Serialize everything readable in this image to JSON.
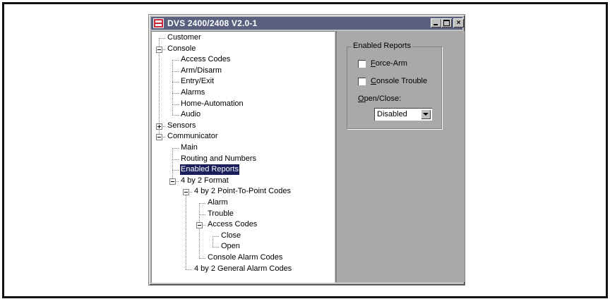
{
  "window": {
    "title": "DVS 2400/2408 V2.0-1",
    "icons": {
      "app": "dvs-app-icon",
      "minimize": "minimize-icon",
      "maximize": "maximize-icon",
      "close": "close-icon"
    },
    "close_glyph": "×"
  },
  "tree": {
    "selected": "Enabled Reports",
    "items": [
      {
        "label": "Customer",
        "depth": 0,
        "expander": "none"
      },
      {
        "label": "Console",
        "depth": 0,
        "expander": "minus"
      },
      {
        "label": "Access Codes",
        "depth": 1,
        "expander": "none"
      },
      {
        "label": "Arm/Disarm",
        "depth": 1,
        "expander": "none"
      },
      {
        "label": "Entry/Exit",
        "depth": 1,
        "expander": "none"
      },
      {
        "label": "Alarms",
        "depth": 1,
        "expander": "none"
      },
      {
        "label": "Home-Automation",
        "depth": 1,
        "expander": "none"
      },
      {
        "label": "Audio",
        "depth": 1,
        "expander": "none"
      },
      {
        "label": "Sensors",
        "depth": 0,
        "expander": "plus"
      },
      {
        "label": "Communicator",
        "depth": 0,
        "expander": "minus"
      },
      {
        "label": "Main",
        "depth": 1,
        "expander": "none"
      },
      {
        "label": "Routing and Numbers",
        "depth": 1,
        "expander": "none"
      },
      {
        "label": "Enabled Reports",
        "depth": 1,
        "expander": "none"
      },
      {
        "label": "4 by 2 Format",
        "depth": 1,
        "expander": "minus"
      },
      {
        "label": "4 by 2 Point-To-Point Codes",
        "depth": 2,
        "expander": "minus"
      },
      {
        "label": "Alarm",
        "depth": 3,
        "expander": "none"
      },
      {
        "label": "Trouble",
        "depth": 3,
        "expander": "none"
      },
      {
        "label": "Access Codes",
        "depth": 3,
        "expander": "minus"
      },
      {
        "label": "Close",
        "depth": 4,
        "expander": "none"
      },
      {
        "label": "Open",
        "depth": 4,
        "expander": "none"
      },
      {
        "label": "Console Alarm Codes",
        "depth": 3,
        "expander": "none"
      },
      {
        "label": "4 by 2 General Alarm Codes",
        "depth": 2,
        "expander": "none"
      }
    ]
  },
  "panel": {
    "group_title": "Enabled Reports",
    "force_arm": {
      "label_first": "F",
      "label_rest": "orce-Arm",
      "checked": false
    },
    "console_trouble": {
      "label_first": "C",
      "label_rest": "onsole Trouble",
      "checked": false
    },
    "open_close": {
      "label_first": "O",
      "label_rest": "pen/Close:"
    },
    "open_close_value": "Disabled"
  },
  "colors": {
    "titlebar": "#5a5f7e",
    "selection": "#1a1f5c",
    "pane": "#a9a9a9"
  }
}
